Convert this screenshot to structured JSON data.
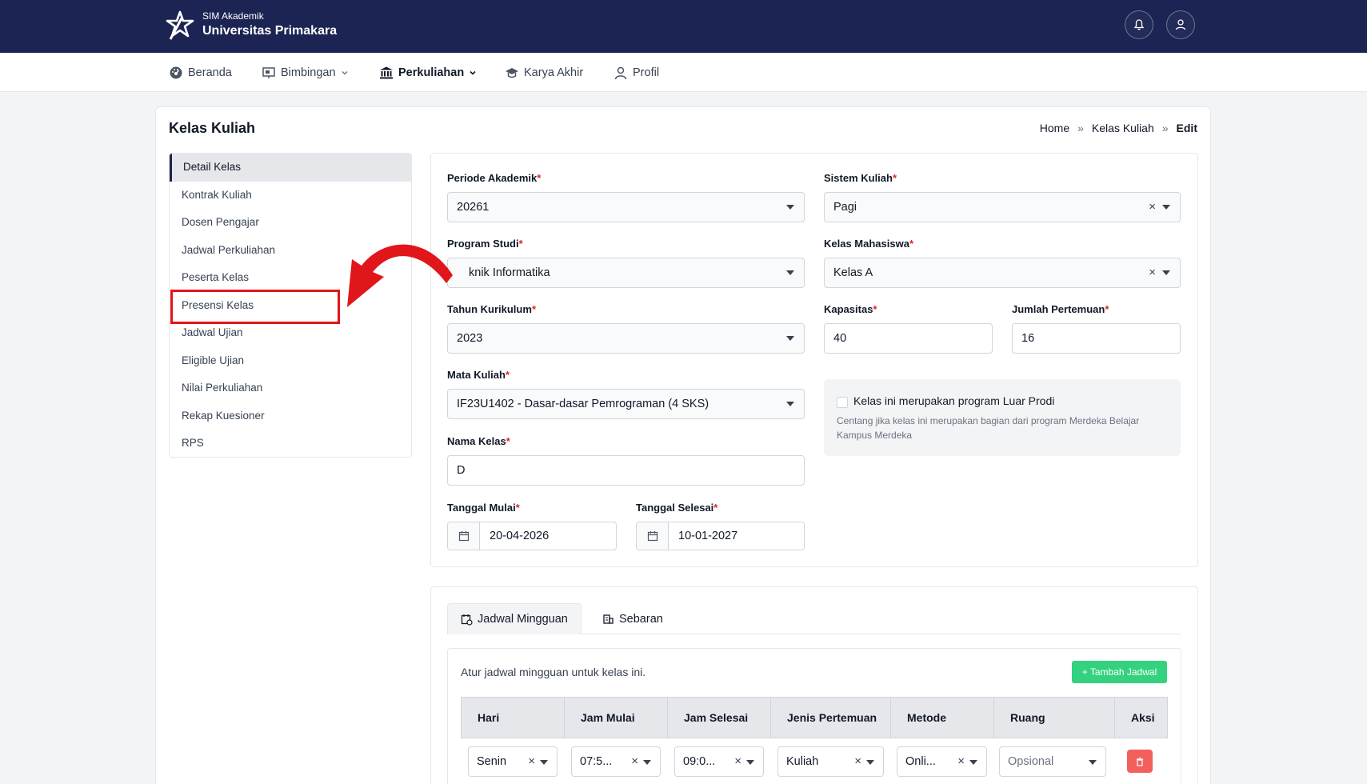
{
  "app": {
    "subtitle": "SIM Akademik",
    "title": "Universitas Primakara"
  },
  "nav": {
    "items": [
      {
        "label": "Beranda"
      },
      {
        "label": "Bimbingan"
      },
      {
        "label": "Perkuliahan"
      },
      {
        "label": "Karya Akhir"
      },
      {
        "label": "Profil"
      }
    ]
  },
  "page": {
    "title": "Kelas Kuliah",
    "breadcrumb": [
      "Home",
      "Kelas Kuliah",
      "Edit"
    ],
    "breadcrumb_sep": "»"
  },
  "sidebar": {
    "items": [
      {
        "label": "Detail Kelas"
      },
      {
        "label": "Kontrak Kuliah"
      },
      {
        "label": "Dosen Pengajar"
      },
      {
        "label": "Jadwal Perkuliahan"
      },
      {
        "label": "Peserta Kelas"
      },
      {
        "label": "Presensi Kelas"
      },
      {
        "label": "Jadwal Ujian"
      },
      {
        "label": "Eligible Ujian"
      },
      {
        "label": "Nilai Perkuliahan"
      },
      {
        "label": "Rekap Kuesioner"
      },
      {
        "label": "RPS"
      }
    ]
  },
  "form": {
    "required_mark": "*",
    "periode": {
      "label": "Periode Akademik",
      "value": "20261"
    },
    "sistem": {
      "label": "Sistem Kuliah",
      "value": "Pagi"
    },
    "prodi": {
      "label": "Program Studi",
      "value": "knik Informatika"
    },
    "kelas_mhs": {
      "label": "Kelas Mahasiswa",
      "value": "Kelas A"
    },
    "kurikulum": {
      "label": "Tahun Kurikulum",
      "value": "2023"
    },
    "kapasitas": {
      "label": "Kapasitas",
      "value": "40"
    },
    "pertemuan": {
      "label": "Jumlah Pertemuan",
      "value": "16"
    },
    "matkul": {
      "label": "Mata Kuliah",
      "value": "IF23U1402 - Dasar-dasar Pemrograman (4 SKS)"
    },
    "nama_kelas": {
      "label": "Nama Kelas",
      "value": "D"
    },
    "tgl_mulai": {
      "label": "Tanggal Mulai",
      "value": "20-04-2026"
    },
    "tgl_selesai": {
      "label": "Tanggal Selesai",
      "value": "10-01-2027"
    },
    "luar_prodi": {
      "label": "Kelas ini merupakan program Luar Prodi",
      "help": "Centang jika kelas ini merupakan bagian dari program Merdeka Belajar Kampus Merdeka",
      "checked": false
    },
    "clear_symbol": "×"
  },
  "schedule": {
    "tabs": [
      {
        "label": "Jadwal Mingguan"
      },
      {
        "label": "Sebaran"
      }
    ],
    "hint": "Atur jadwal mingguan untuk kelas ini.",
    "add_button": "+ Tambah Jadwal",
    "columns": [
      "Hari",
      "Jam Mulai",
      "Jam Selesai",
      "Jenis Pertemuan",
      "Metode",
      "Ruang",
      "Aksi"
    ],
    "row": {
      "hari": "Senin",
      "jam_mulai": "07:5...",
      "jam_selesai": "09:0...",
      "jenis": "Kuliah",
      "metode": "Onli...",
      "ruang_placeholder": "Opsional"
    }
  },
  "colors": {
    "topbar": "#1b2452",
    "highlight": "#e0161b",
    "add_button": "#34d17f",
    "delete_button": "#f2605d"
  }
}
